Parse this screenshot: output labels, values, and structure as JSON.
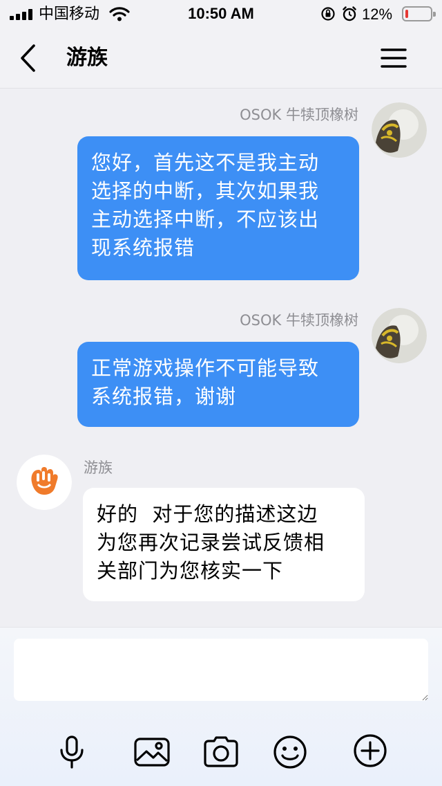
{
  "status_bar": {
    "carrier": "中国移动",
    "time": "10:50 AM",
    "battery_percent": "12%",
    "battery_level": 0.12,
    "signal_bars": 4
  },
  "nav": {
    "title": "游族",
    "back_icon": "chevron-left-icon",
    "menu_icon": "hamburger-menu-icon"
  },
  "messages": [
    {
      "sender": "OSOK 牛犊顶橡树",
      "direction": "outgoing",
      "lines": [
        "您好，首先这不是我主动",
        "选择的中断，其次如果我",
        "主动选择中断，不应该出",
        "现系统报错"
      ]
    },
    {
      "sender": "OSOK 牛犊顶橡树",
      "direction": "outgoing",
      "lines": [
        "正常游戏操作不可能导致",
        "系统报错，谢谢"
      ]
    },
    {
      "sender": "游族",
      "direction": "incoming",
      "lines": [
        "好的  对于您的描述这边",
        "为您再次记录尝试反馈相",
        "关部门为您核实一下"
      ]
    }
  ],
  "composer": {
    "input_value": "",
    "tools": [
      "microphone-icon",
      "image-icon",
      "camera-icon",
      "emoji-icon",
      "plus-icon"
    ]
  },
  "colors": {
    "outgoing_bubble": "#3d8ff5",
    "incoming_bubble": "#ffffff",
    "background": "#efeff3",
    "brand_orange": "#f07b2b",
    "battery_low": "#e53935"
  }
}
